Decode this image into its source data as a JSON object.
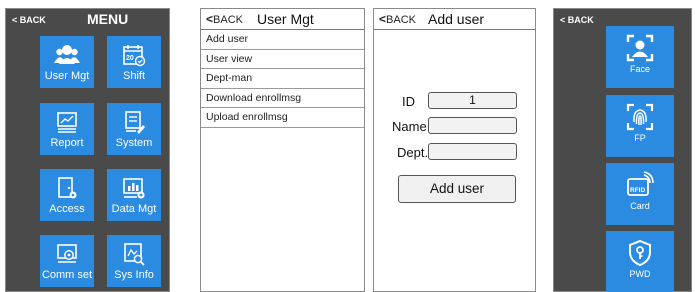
{
  "menu_screen": {
    "back_label": "< BACK",
    "title": "MENU",
    "tiles": [
      {
        "label": "User Mgt",
        "icon": "users-icon"
      },
      {
        "label": "Shift",
        "icon": "calendar-icon"
      },
      {
        "label": "Report",
        "icon": "report-icon"
      },
      {
        "label": "System",
        "icon": "system-icon"
      },
      {
        "label": "Access",
        "icon": "door-icon"
      },
      {
        "label": "Data Mgt",
        "icon": "data-mgt-icon"
      },
      {
        "label": "Comm set",
        "icon": "comm-set-icon"
      },
      {
        "label": "Sys Info",
        "icon": "sys-info-icon"
      }
    ]
  },
  "user_mgt_screen": {
    "back_label": "BACK",
    "title": "User Mgt",
    "items": [
      "Add user",
      "User view",
      "Dept-man",
      "Download enrollmsg",
      "Upload enrollmsg"
    ]
  },
  "add_user_screen": {
    "back_label": "BACK",
    "title": "Add user",
    "id_label": "ID",
    "id_value": "1",
    "name_label": "Name",
    "name_value": "",
    "dept_label": "Dept.",
    "dept_value": "",
    "submit_label": "Add user"
  },
  "enroll_screen": {
    "back_label": "< BACK",
    "options": [
      {
        "label": "Face",
        "icon": "face-icon"
      },
      {
        "label": "FP",
        "icon": "fingerprint-icon"
      },
      {
        "label": "Card",
        "icon": "rfid-card-icon",
        "icon_text": "RFID"
      },
      {
        "label": "PWD",
        "icon": "password-icon"
      }
    ]
  },
  "colors": {
    "panel_dark": "#4a4a4a",
    "tile_blue": "#2a8be0"
  }
}
